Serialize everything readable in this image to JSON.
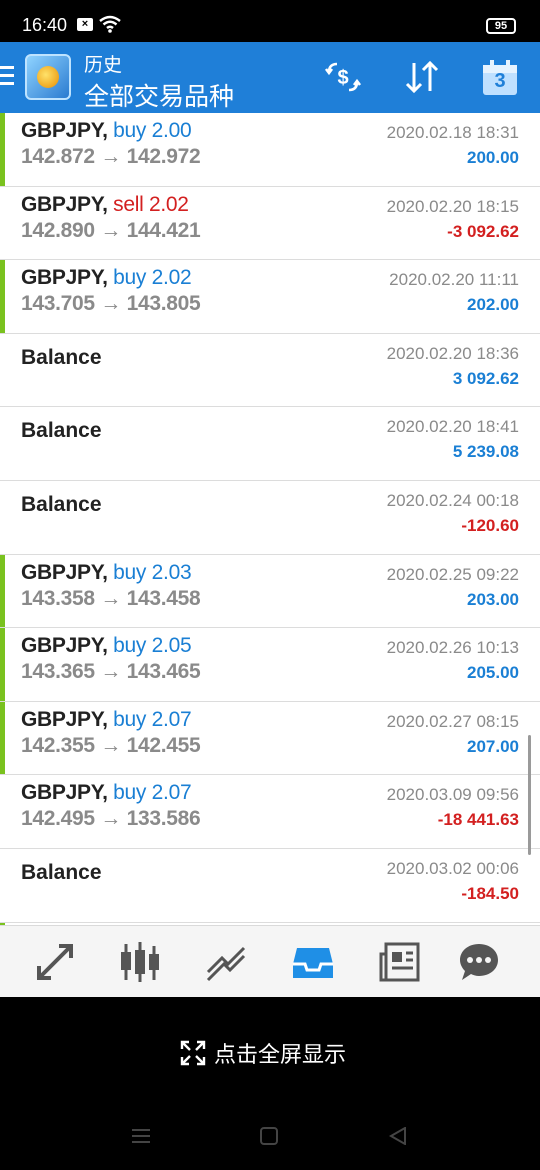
{
  "status": {
    "time": "16:40",
    "battery": "95"
  },
  "header": {
    "subtitle": "历史",
    "title": "全部交易品种",
    "calendar_day": "3"
  },
  "rows": [
    {
      "type": "trade",
      "symbol": "GBPJPY,",
      "side": "buy",
      "volume": "buy 2.00",
      "open": "142.872",
      "close": "142.972",
      "arrow": "→",
      "datetime": "2020.02.18 18:31",
      "profit": "200.00",
      "positive": true,
      "bar": true
    },
    {
      "type": "trade",
      "symbol": "GBPJPY,",
      "side": "sell",
      "volume": "sell 2.02",
      "open": "142.890",
      "close": "144.421",
      "arrow": "→",
      "datetime": "2020.02.20 18:15",
      "profit": "-3 092.62",
      "positive": false,
      "bar": false
    },
    {
      "type": "trade",
      "symbol": "GBPJPY,",
      "side": "buy",
      "volume": "buy 2.02",
      "open": "143.705",
      "close": "143.805",
      "arrow": "→",
      "datetime": "2020.02.20 11:11",
      "profit": "202.00",
      "positive": true,
      "bar": true
    },
    {
      "type": "balance",
      "label": "Balance",
      "datetime": "2020.02.20 18:36",
      "profit": "3 092.62",
      "positive": true
    },
    {
      "type": "balance",
      "label": "Balance",
      "datetime": "2020.02.20 18:41",
      "profit": "5 239.08",
      "positive": true
    },
    {
      "type": "balance",
      "label": "Balance",
      "datetime": "2020.02.24 00:18",
      "profit": "-120.60",
      "positive": false
    },
    {
      "type": "trade",
      "symbol": "GBPJPY,",
      "side": "buy",
      "volume": "buy 2.03",
      "open": "143.358",
      "close": "143.458",
      "arrow": "→",
      "datetime": "2020.02.25 09:22",
      "profit": "203.00",
      "positive": true,
      "bar": true
    },
    {
      "type": "trade",
      "symbol": "GBPJPY,",
      "side": "buy",
      "volume": "buy 2.05",
      "open": "143.365",
      "close": "143.465",
      "arrow": "→",
      "datetime": "2020.02.26 10:13",
      "profit": "205.00",
      "positive": true,
      "bar": true
    },
    {
      "type": "trade",
      "symbol": "GBPJPY,",
      "side": "buy",
      "volume": "buy 2.07",
      "open": "142.355",
      "close": "142.455",
      "arrow": "→",
      "datetime": "2020.02.27 08:15",
      "profit": "207.00",
      "positive": true,
      "bar": true
    },
    {
      "type": "trade",
      "symbol": "GBPJPY,",
      "side": "buy",
      "volume": "buy 2.07",
      "open": "142.495",
      "close": "133.586",
      "arrow": "→",
      "datetime": "2020.03.09 09:56",
      "profit": "-18 441.63",
      "positive": false,
      "bar": false
    },
    {
      "type": "balance",
      "label": "Balance",
      "datetime": "2020.03.02 00:06",
      "profit": "-184.50",
      "positive": false
    }
  ],
  "bottom_nav": [
    "trade-arrows-icon",
    "candlestick-icon",
    "chart-line-icon",
    "history-inbox-icon",
    "news-icon",
    "chat-icon"
  ],
  "fullscreen": {
    "label": "点击全屏显示"
  },
  "colors": {
    "accent": "#1f7fd8",
    "buy": "#1a7fd4",
    "sell": "#d32020",
    "bar": "#7ac21f"
  }
}
